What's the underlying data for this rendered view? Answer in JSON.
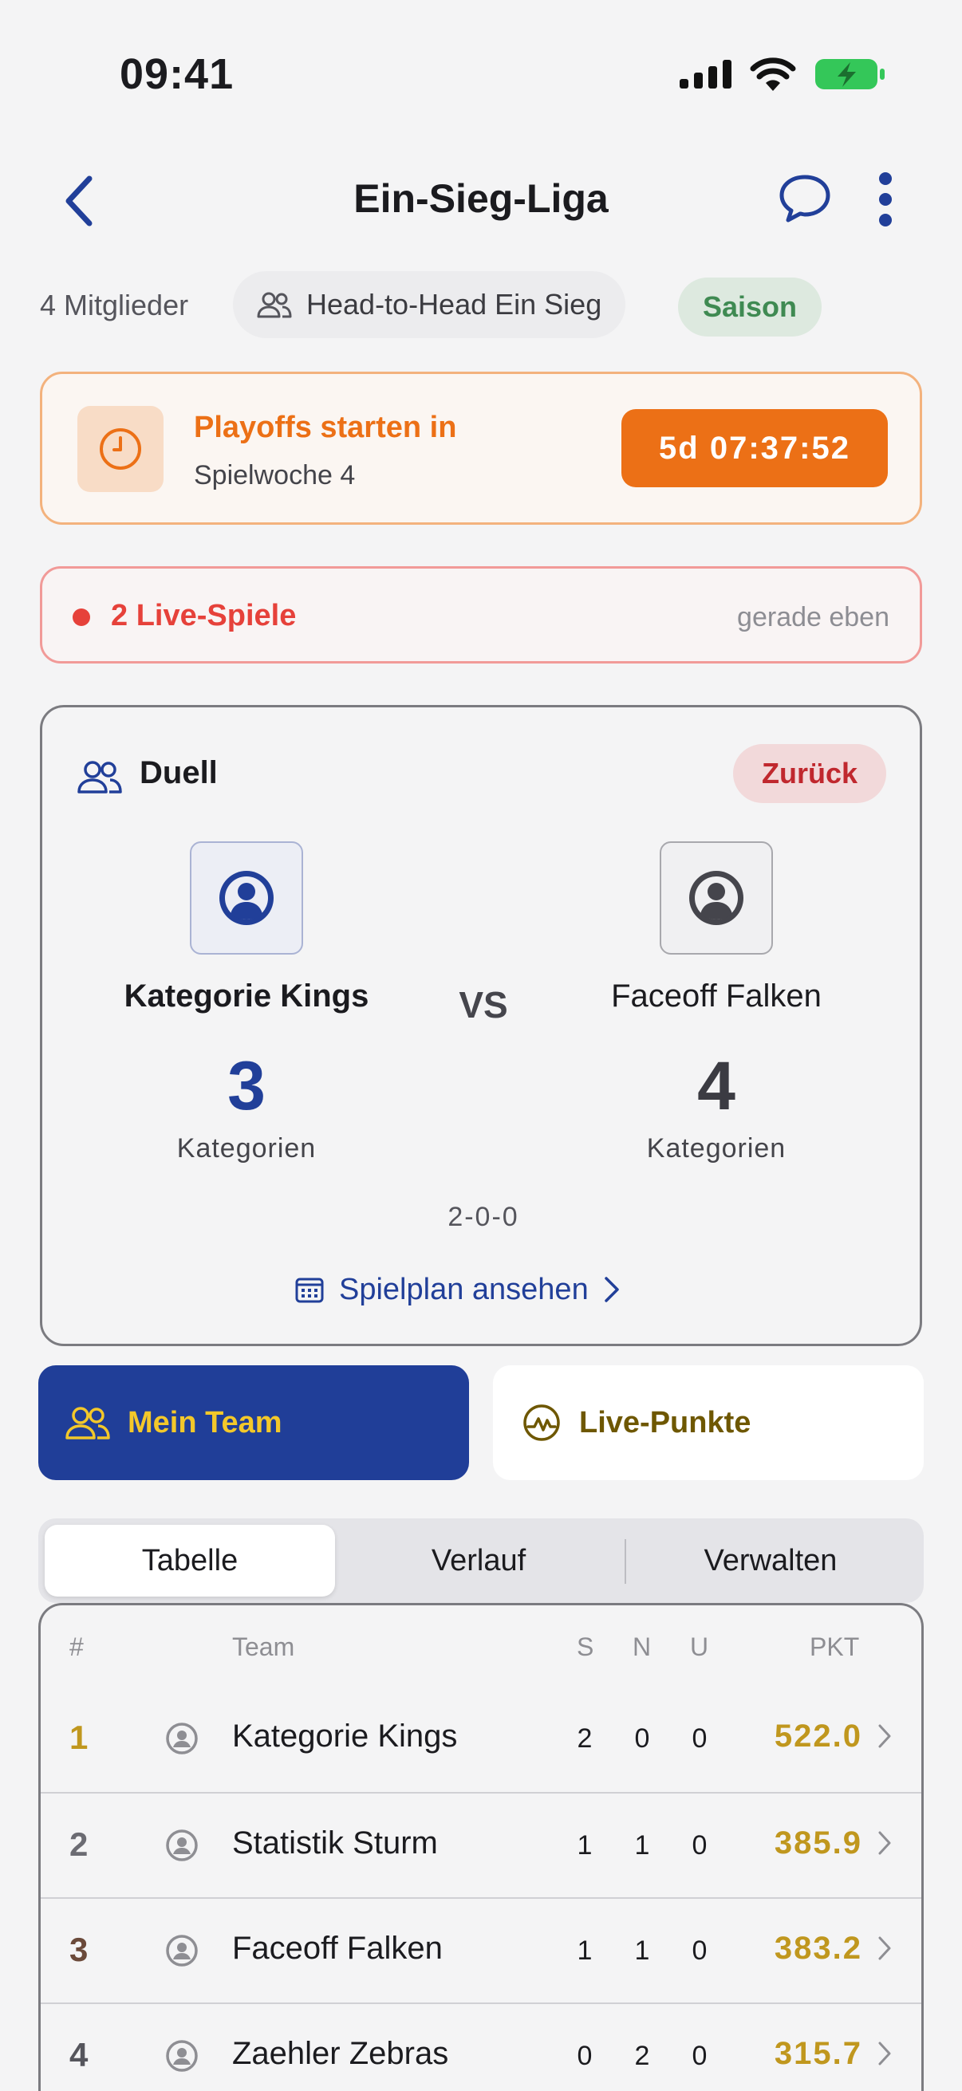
{
  "status_bar": {
    "time": "09:41"
  },
  "nav": {
    "title": "Ein-Sieg-Liga"
  },
  "meta": {
    "members": "4 Mitglieder",
    "format": "Head-to-Head Ein Sieg",
    "season": "Saison"
  },
  "playoffs": {
    "title": "Playoffs starten in",
    "subtitle": "Spielwoche 4",
    "countdown": "5d 07:37:52"
  },
  "live": {
    "label": "2 Live-Spiele",
    "updated": "gerade eben"
  },
  "duel": {
    "title": "Duell",
    "back_label": "Zurück",
    "vs": "VS",
    "home": {
      "name": "Kategorie Kings",
      "score": "3",
      "score_label": "Kategorien"
    },
    "away": {
      "name": "Faceoff Falken",
      "score": "4",
      "score_label": "Kategorien"
    },
    "record": "2-0-0",
    "schedule_link": "Spielplan ansehen"
  },
  "actions": {
    "my_team": "Mein Team",
    "live_points": "Live-Punkte"
  },
  "tabs": {
    "standings": "Tabelle",
    "history": "Verlauf",
    "manage": "Verwalten"
  },
  "table": {
    "headers": {
      "rank": "#",
      "team": "Team",
      "w": "S",
      "l": "N",
      "t": "U",
      "pts": "PKT"
    },
    "rows": [
      {
        "rank": "1",
        "team": "Kategorie Kings",
        "w": "2",
        "l": "0",
        "t": "0",
        "pts": "522.0",
        "rank_color": "#c0971e"
      },
      {
        "rank": "2",
        "team": "Statistik Sturm",
        "w": "1",
        "l": "1",
        "t": "0",
        "pts": "385.9",
        "rank_color": "#6b6b72"
      },
      {
        "rank": "3",
        "team": "Faceoff Falken",
        "w": "1",
        "l": "1",
        "t": "0",
        "pts": "383.2",
        "rank_color": "#6b4a3a"
      },
      {
        "rank": "4",
        "team": "Zaehler Zebras",
        "w": "0",
        "l": "2",
        "t": "0",
        "pts": "315.7",
        "rank_color": "#55555c"
      }
    ]
  },
  "colors": {
    "primary": "#203e98",
    "accent_gold": "#f3c82a",
    "orange": "#ec7016",
    "live_red": "#e6413a",
    "season_green": "#3f8a52"
  }
}
